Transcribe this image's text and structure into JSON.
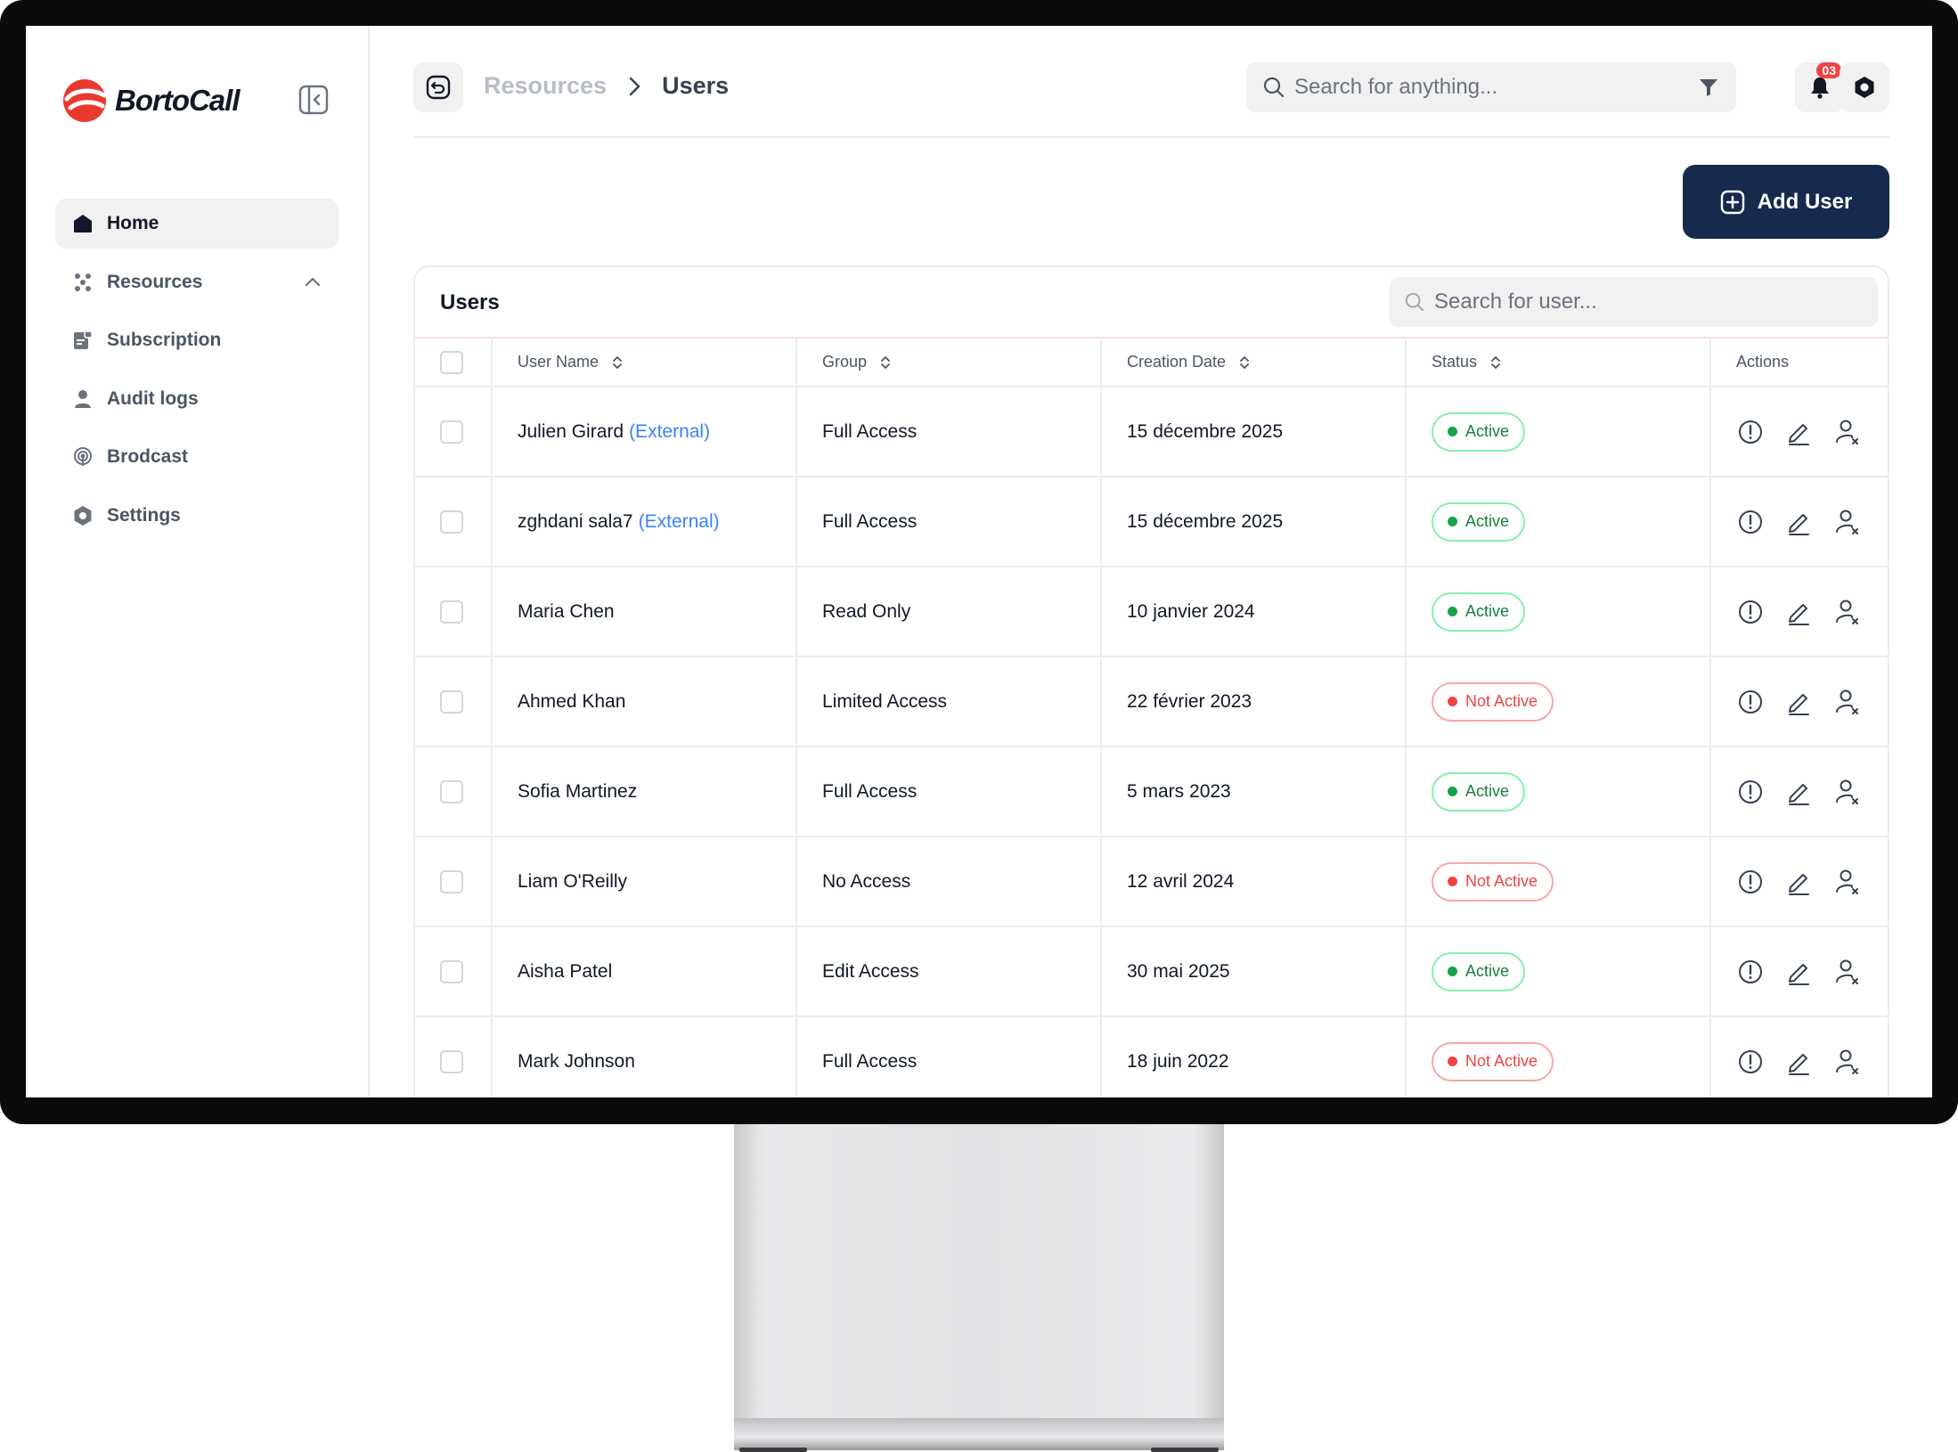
{
  "sidebar": {
    "brand": "BortoCall",
    "items": [
      {
        "label": "Home",
        "icon": "home-icon",
        "active": true
      },
      {
        "label": "Resources",
        "icon": "resources-icon",
        "active": false
      },
      {
        "label": "Subscription",
        "icon": "subscription-icon",
        "active": false
      },
      {
        "label": "Audit logs",
        "icon": "user-icon",
        "active": false
      },
      {
        "label": "Brodcast",
        "icon": "broadcast-icon",
        "active": false
      },
      {
        "label": "Settings",
        "icon": "gear-icon",
        "active": false
      }
    ]
  },
  "header": {
    "breadcrumb": {
      "parent": "Resources",
      "current": "Users"
    },
    "search_placeholder": "Search for anything...",
    "notification_count": "03"
  },
  "actions": {
    "add_user_label": "Add User"
  },
  "table": {
    "title": "Users",
    "search_placeholder": "Search for user...",
    "columns": [
      "User Name",
      "Group",
      "Creation Date",
      "Status",
      "Actions"
    ],
    "rows": [
      {
        "name": "Julien Girard",
        "tag": "(External)",
        "group": "Full Access",
        "date": "15 décembre 2025",
        "status": "Active"
      },
      {
        "name": "zghdani sala7",
        "tag": "(External)",
        "group": "Full Access",
        "date": "15 décembre 2025",
        "status": "Active"
      },
      {
        "name": "Maria Chen",
        "tag": "",
        "group": "Read Only",
        "date": "10 janvier 2024",
        "status": "Active"
      },
      {
        "name": "Ahmed Khan",
        "tag": "",
        "group": "Limited Access",
        "date": "22 février 2023",
        "status": "Not Active"
      },
      {
        "name": "Sofia Martinez",
        "tag": "",
        "group": "Full Access",
        "date": "5 mars 2023",
        "status": "Active"
      },
      {
        "name": "Liam O'Reilly",
        "tag": "",
        "group": "No Access",
        "date": "12 avril 2024",
        "status": "Not Active"
      },
      {
        "name": "Aisha Patel",
        "tag": "",
        "group": "Edit Access",
        "date": "30 mai 2025",
        "status": "Active"
      },
      {
        "name": "Mark Johnson",
        "tag": "",
        "group": "Full Access",
        "date": "18 juin 2022",
        "status": "Not Active"
      }
    ]
  },
  "colors": {
    "brand": "#e9392f",
    "primary_button": "#152a4c",
    "active_status": "#16a34a",
    "inactive_status": "#ef4444",
    "external_link": "#3b82f6"
  }
}
